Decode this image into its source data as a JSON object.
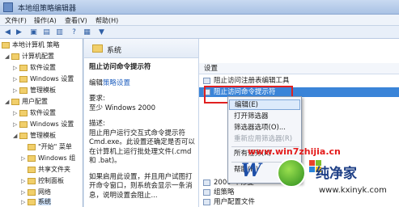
{
  "window": {
    "title": "本地组策略编辑器"
  },
  "menu": [
    {
      "id": "file",
      "label": "文件(F)"
    },
    {
      "id": "action",
      "label": "操作(A)"
    },
    {
      "id": "view",
      "label": "查看(V)"
    },
    {
      "id": "help",
      "label": "帮助(H)"
    }
  ],
  "tree": {
    "items": [
      {
        "label": "本地计算机 策略",
        "indent": 0
      },
      {
        "label": "计算机配置",
        "indent": 1
      },
      {
        "label": "软件设置",
        "indent": 2
      },
      {
        "label": "Windows 设置",
        "indent": 2
      },
      {
        "label": "管理模板",
        "indent": 2
      },
      {
        "label": "用户配置",
        "indent": 1
      },
      {
        "label": "软件设置",
        "indent": 2
      },
      {
        "label": "Windows 设置",
        "indent": 2
      },
      {
        "label": "管理模板",
        "indent": 2
      },
      {
        "label": "\"开始\" 菜单",
        "indent": 3
      },
      {
        "label": "Windows 组",
        "indent": 3
      },
      {
        "label": "共享文件夹",
        "indent": 3
      },
      {
        "label": "控制面板",
        "indent": 3
      },
      {
        "label": "网络",
        "indent": 3
      },
      {
        "label": "系统",
        "indent": 3,
        "selected": true
      }
    ]
  },
  "description": {
    "folder_title": "系统",
    "setting_title": "阻止访问命令提示符",
    "edit_prefix": "编辑",
    "edit_link": "策略设置",
    "requirement_label": "要求:",
    "requirement_value": "至少 Windows 2000",
    "desc_label": "描述:",
    "desc_text": "阻止用户运行交互式命令提示符 Cmd.exe。此设置还确定是否可以在计算机上运行批处理文件(.cmd 和 .bat)。",
    "desc_text2": "如果启用此设置，并且用户试图打开命令窗口，则系统会显示一条消息，说明设置会阻止..."
  },
  "list": {
    "header": "设置",
    "rows": [
      {
        "label": "阻止访问注册表编辑工具",
        "selected": false
      },
      {
        "label": "阻止访问命令提示符",
        "selected": true
      },
      {
        "label": "2000 年修复",
        "selected": false
      },
      {
        "label": "组策略",
        "selected": false
      },
      {
        "label": "用户配置文件",
        "selected": false
      }
    ]
  },
  "context_menu": {
    "items": [
      {
        "label": "编辑(E)",
        "style": "edit"
      },
      {
        "label": "打开筛选器",
        "style": "normal"
      },
      {
        "label": "筛选器选项(O)...",
        "style": "normal"
      },
      {
        "label": "重新应用筛选器(R)",
        "style": "disabled"
      },
      {
        "label": "所有任务(K)",
        "style": "normal"
      },
      {
        "label": "帮助(H)",
        "style": "normal"
      }
    ]
  },
  "watermark": {
    "text": "www.win7zhijia.cn"
  },
  "logo": {
    "brand_cn": "纯净家",
    "url": "www.kxinyk.com"
  },
  "colors": {
    "selection": "#3a84d8",
    "highlight_box": "#e02020",
    "link": "#1f5fbf"
  }
}
